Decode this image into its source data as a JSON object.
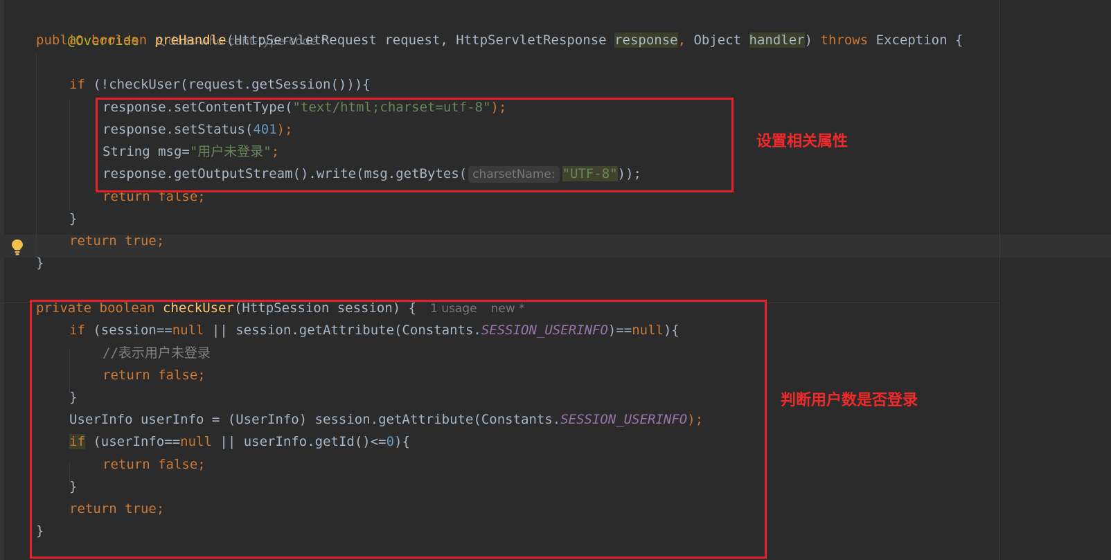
{
  "meta": {
    "author": "dazs-who-cant-type-code *",
    "usages": "1 usage",
    "new_tag": "new *"
  },
  "code": {
    "l1_override": "@Override",
    "l2_public": "public ",
    "l2_boolean": "boolean ",
    "l2_method": "preHandle",
    "l2_params_a": "(HttpServletRequest request, HttpServletResponse ",
    "l2_response": "response",
    "l2_comma": ", ",
    "l2_object": "Object ",
    "l2_handler": "handler",
    "l2_close": ") ",
    "l2_throws": "throws ",
    "l2_exception": "Exception {",
    "l4_if": "if ",
    "l4_cond": "(!checkUser(request.getSession())){",
    "l5_a": "response.setContentType(",
    "l5_str": "\"text/html;charset=utf-8\"",
    "l5_end": ");",
    "l6_a": "response.setStatus(",
    "l6_num": "401",
    "l6_end": ");",
    "l7_a": "String msg=",
    "l7_str": "\"用户未登录\"",
    "l7_end": ";",
    "l8_a": "response.getOutputStream().write(msg.getBytes(",
    "l8_hint": "charsetName:",
    "l8_str": "\"UTF-8\"",
    "l8_end": "));",
    "return_kw": "return ",
    "false_kw": "false",
    "true_kw": "true",
    "semi": ";",
    "brace_close": "}",
    "l13_private": "private ",
    "l13_boolean": "boolean ",
    "l13_method": "checkUser",
    "l13_params": "(HttpSession session) {",
    "l14_if": "if ",
    "l14_a": "(session==",
    "null_kw": "null",
    "l14_b": " || session.getAttribute(Constants.",
    "const_userinfo": "SESSION_USERINFO",
    "l14_c": ")==",
    "l14_end": "){",
    "l15_comment": "//表示用户未登录",
    "l18_a": "UserInfo userInfo = (UserInfo) session.getAttribute(Constants.",
    "l18_end": ");",
    "l19_if": "if",
    "l19_a": " (userInfo==",
    "l19_b": " || userInfo.getId()<=",
    "l19_num": "0",
    "l19_end": "){"
  },
  "annotations": {
    "set_props": "设置相关属性",
    "check_login": "判断用户数是否登录"
  },
  "colors": {
    "background": "#2b2b2b",
    "keyword": "#cc7832",
    "function": "#ffc66d",
    "string": "#6a8759",
    "number": "#6897bb",
    "constant": "#9876aa",
    "highlight_box": "#e8202a"
  }
}
